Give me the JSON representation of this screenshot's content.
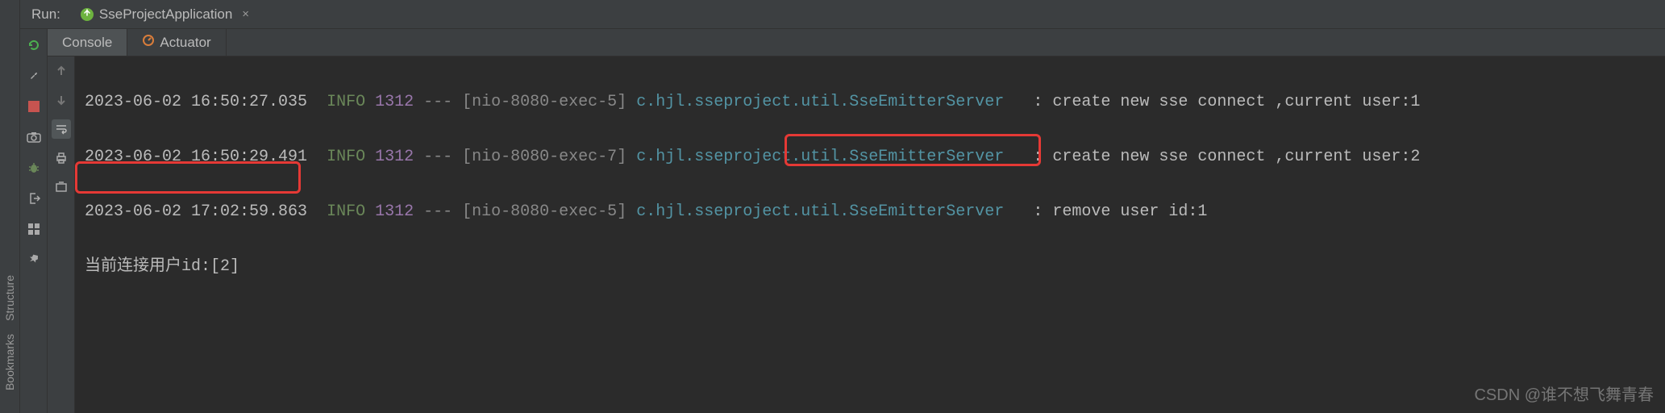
{
  "sidebar": {
    "labels": [
      "Structure",
      "Bookmarks"
    ]
  },
  "topbar": {
    "run_label": "Run:",
    "config_name": "SseProjectApplication"
  },
  "tool_icons": [
    "rerun-icon",
    "wrench-icon",
    "stop-icon",
    "camera-icon",
    "bug-icon",
    "exit-icon",
    "layout-icon",
    "pin-icon"
  ],
  "tabs": [
    {
      "label": "Console",
      "active": true
    },
    {
      "label": "Actuator",
      "active": false,
      "icon": "actuator-icon"
    }
  ],
  "gutter_icons": [
    "arrow-up-icon",
    "arrow-down-icon",
    "wrap-icon",
    "print-icon",
    "clear-icon"
  ],
  "log": [
    {
      "ts": "2023-06-02 16:50:27.035",
      "level": "INFO",
      "pid": "1312",
      "dashes": "---",
      "thread": "[nio-8080-exec-5]",
      "logger": "c.hjl.sseproject.util.SseEmitterServer",
      "msg": ": create new sse connect ,current user:1"
    },
    {
      "ts": "2023-06-02 16:50:29.491",
      "level": "INFO",
      "pid": "1312",
      "dashes": "---",
      "thread": "[nio-8080-exec-7]",
      "logger": "c.hjl.sseproject.util.SseEmitterServer",
      "msg": ": create new sse connect ,current user:2"
    },
    {
      "ts": "2023-06-02 17:02:59.863",
      "level": "INFO",
      "pid": "1312",
      "dashes": "---",
      "thread": "[nio-8080-exec-5]",
      "logger": "c.hjl.sseproject.util.SseEmitterServer",
      "msg": ": remove user id:1"
    }
  ],
  "stdout_line": "当前连接用户id:[2]",
  "watermark": "CSDN @谁不想飞舞青春"
}
